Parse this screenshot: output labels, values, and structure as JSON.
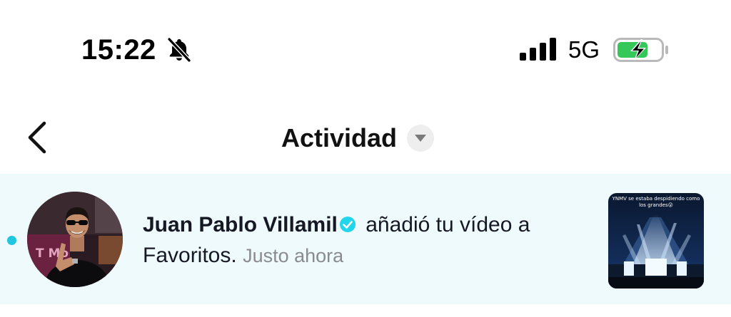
{
  "status_bar": {
    "time": "15:22",
    "silent_icon": "bell-slash-icon",
    "signal_icon": "cellular-signal-icon",
    "network": "5G",
    "battery_icon": "battery-charging-icon",
    "battery_color": "#34c759"
  },
  "header": {
    "back_icon": "chevron-left-icon",
    "title": "Actividad",
    "dropdown_icon": "caret-down-icon"
  },
  "notifications": [
    {
      "unread": true,
      "unread_color": "#20c5e0",
      "username": "Juan Pablo Villamil",
      "verified": true,
      "verified_color": "#20d5ec",
      "action": " añadió tu vídeo a Favoritos.",
      "time": "Justo ahora",
      "thumbnail_caption": "YNMV se estaba despidiendo como los grandes😮"
    }
  ]
}
